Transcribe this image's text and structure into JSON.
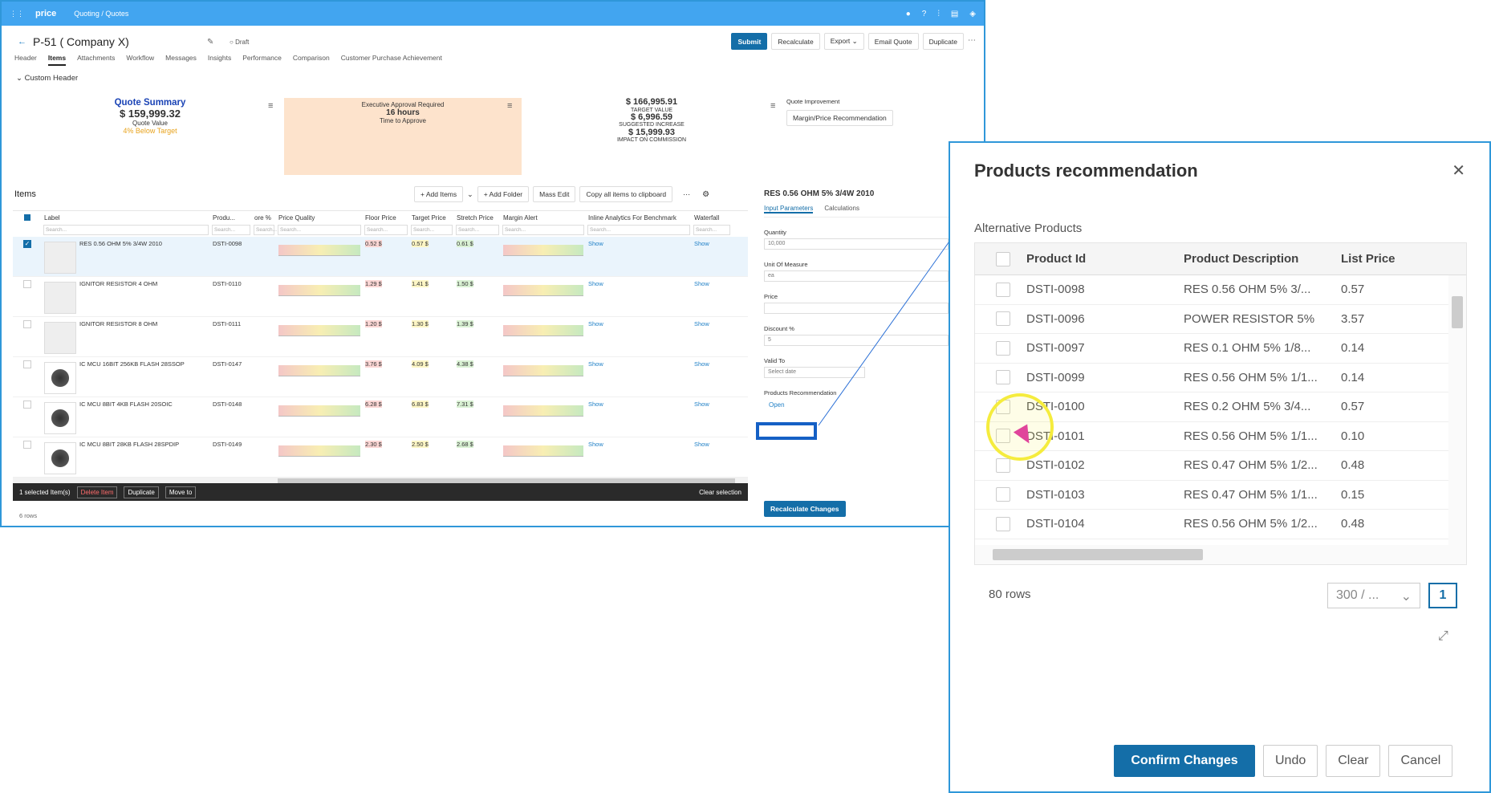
{
  "topbar": {
    "logo": "price",
    "crumb": "Quoting / Quotes"
  },
  "header": {
    "title": "P-51 ( Company X)",
    "status": "Draft",
    "actions": {
      "submit": "Submit",
      "recalc": "Recalculate",
      "export": "Export",
      "email": "Email Quote",
      "duplicate": "Duplicate"
    }
  },
  "tabs": [
    "Header",
    "Items",
    "Attachments",
    "Workflow",
    "Messages",
    "Insights",
    "Performance",
    "Comparison",
    "Customer Purchase Achievement"
  ],
  "custom_header": "Custom Header",
  "summary": {
    "title": "Quote Summary",
    "value": "$ 159,999.32",
    "value_label": "Quote Value",
    "below": "4% Below Target"
  },
  "approval": {
    "line1": "Executive Approval Required",
    "hours": "16 hours",
    "line3": "Time to Approve"
  },
  "targets": {
    "target_value": "$ 166,995.91",
    "target_label": "TARGET VALUE",
    "suggested": "$ 6,996.59",
    "suggested_label": "SUGGESTED INCREASE",
    "impact": "$ 15,999.93",
    "impact_label": "IMPACT ON COMMISSION"
  },
  "improvement": {
    "title": "Quote Improvement",
    "button": "Margin/Price Recommendation"
  },
  "items": {
    "title": "Items",
    "toolbar": {
      "add_items": "Add Items",
      "add_folder": "Add Folder",
      "mass_edit": "Mass Edit",
      "copy": "Copy all items to clipboard"
    },
    "columns": [
      "Label",
      "Produ...",
      "ore %",
      "Price Quality",
      "Floor Price",
      "Target Price",
      "Stretch Price",
      "Margin Alert",
      "Inline Analytics For Benchmark",
      "Waterfall"
    ],
    "search_placeholder": "Search...",
    "rows": [
      {
        "label": "RES 0.56 OHM 5% 3/4W 2010",
        "product": "DSTI-0098",
        "floor": "0.52 $",
        "target": "0.57 $",
        "stretch": "0.61 $",
        "show1": "Show",
        "show2": "Show"
      },
      {
        "label": "IGNITOR RESISTOR 4 OHM",
        "product": "DSTI-0110",
        "floor": "1.29 $",
        "target": "1.41 $",
        "stretch": "1.50 $",
        "show1": "Show",
        "show2": "Show"
      },
      {
        "label": "IGNITOR RESISTOR 8 OHM",
        "product": "DSTI-0111",
        "floor": "1.20 $",
        "target": "1.30 $",
        "stretch": "1.39 $",
        "show1": "Show",
        "show2": "Show"
      },
      {
        "label": "IC MCU 16BIT 256KB FLASH 28SSOP",
        "product": "DSTI-0147",
        "floor": "3.76 $",
        "target": "4.09 $",
        "stretch": "4.38 $",
        "show1": "Show",
        "show2": "Show"
      },
      {
        "label": "IC MCU 8BIT 4KB FLASH 20SOIC",
        "product": "DSTI-0148",
        "floor": "6.28 $",
        "target": "6.83 $",
        "stretch": "7.31 $",
        "show1": "Show",
        "show2": "Show"
      },
      {
        "label": "IC MCU 8BIT 28KB FLASH 28SPDIP",
        "product": "DSTI-0149",
        "floor": "2.30 $",
        "target": "2.50 $",
        "stretch": "2.68 $",
        "show1": "Show",
        "show2": "Show"
      }
    ],
    "selection": {
      "count": "1 selected Item(s)",
      "delete": "Delete Item",
      "duplicate": "Duplicate",
      "move": "Move to",
      "clear": "Clear selection"
    },
    "row_count": "6 rows"
  },
  "detail": {
    "title": "RES 0.56 OHM 5% 3/4W 2010",
    "tabs": [
      "Input Parameters",
      "Calculations"
    ],
    "quantity_label": "Quantity",
    "quantity": "10,000",
    "uom_label": "Unit Of Measure",
    "uom": "ea",
    "price_label": "Price",
    "discount_label": "Discount %",
    "discount": "5",
    "valid_label": "Valid To",
    "valid_placeholder": "Select date",
    "reco_label": "Products Recommendation",
    "open": "Open",
    "recalc_btn": "Recalculate Changes"
  },
  "modal": {
    "title": "Products recommendation",
    "subtitle": "Alternative Products",
    "columns": [
      "Product Id",
      "Product Description",
      "List Price"
    ],
    "rows": [
      {
        "id": "DSTI-0098",
        "desc": "RES 0.56 OHM 5% 3/...",
        "price": "0.57"
      },
      {
        "id": "DSTI-0096",
        "desc": "POWER RESISTOR 5%",
        "price": "3.57"
      },
      {
        "id": "DSTI-0097",
        "desc": "RES 0.1 OHM 5% 1/8...",
        "price": "0.14"
      },
      {
        "id": "DSTI-0099",
        "desc": "RES 0.56 OHM 5% 1/1...",
        "price": "0.14"
      },
      {
        "id": "DSTI-0100",
        "desc": "RES 0.2 OHM 5% 3/4...",
        "price": "0.57"
      },
      {
        "id": "DSTI-0101",
        "desc": "RES 0.56 OHM 5% 1/1...",
        "price": "0.10"
      },
      {
        "id": "DSTI-0102",
        "desc": "RES 0.47 OHM 5% 1/2...",
        "price": "0.48"
      },
      {
        "id": "DSTI-0103",
        "desc": "RES 0.47 OHM 5% 1/1...",
        "price": "0.15"
      },
      {
        "id": "DSTI-0104",
        "desc": "RES 0.56 OHM 5% 1/2...",
        "price": "0.48"
      }
    ],
    "row_count": "80 rows",
    "page_size": "300 / ...",
    "page": "1",
    "buttons": {
      "confirm": "Confirm Changes",
      "undo": "Undo",
      "clear": "Clear",
      "cancel": "Cancel"
    }
  }
}
